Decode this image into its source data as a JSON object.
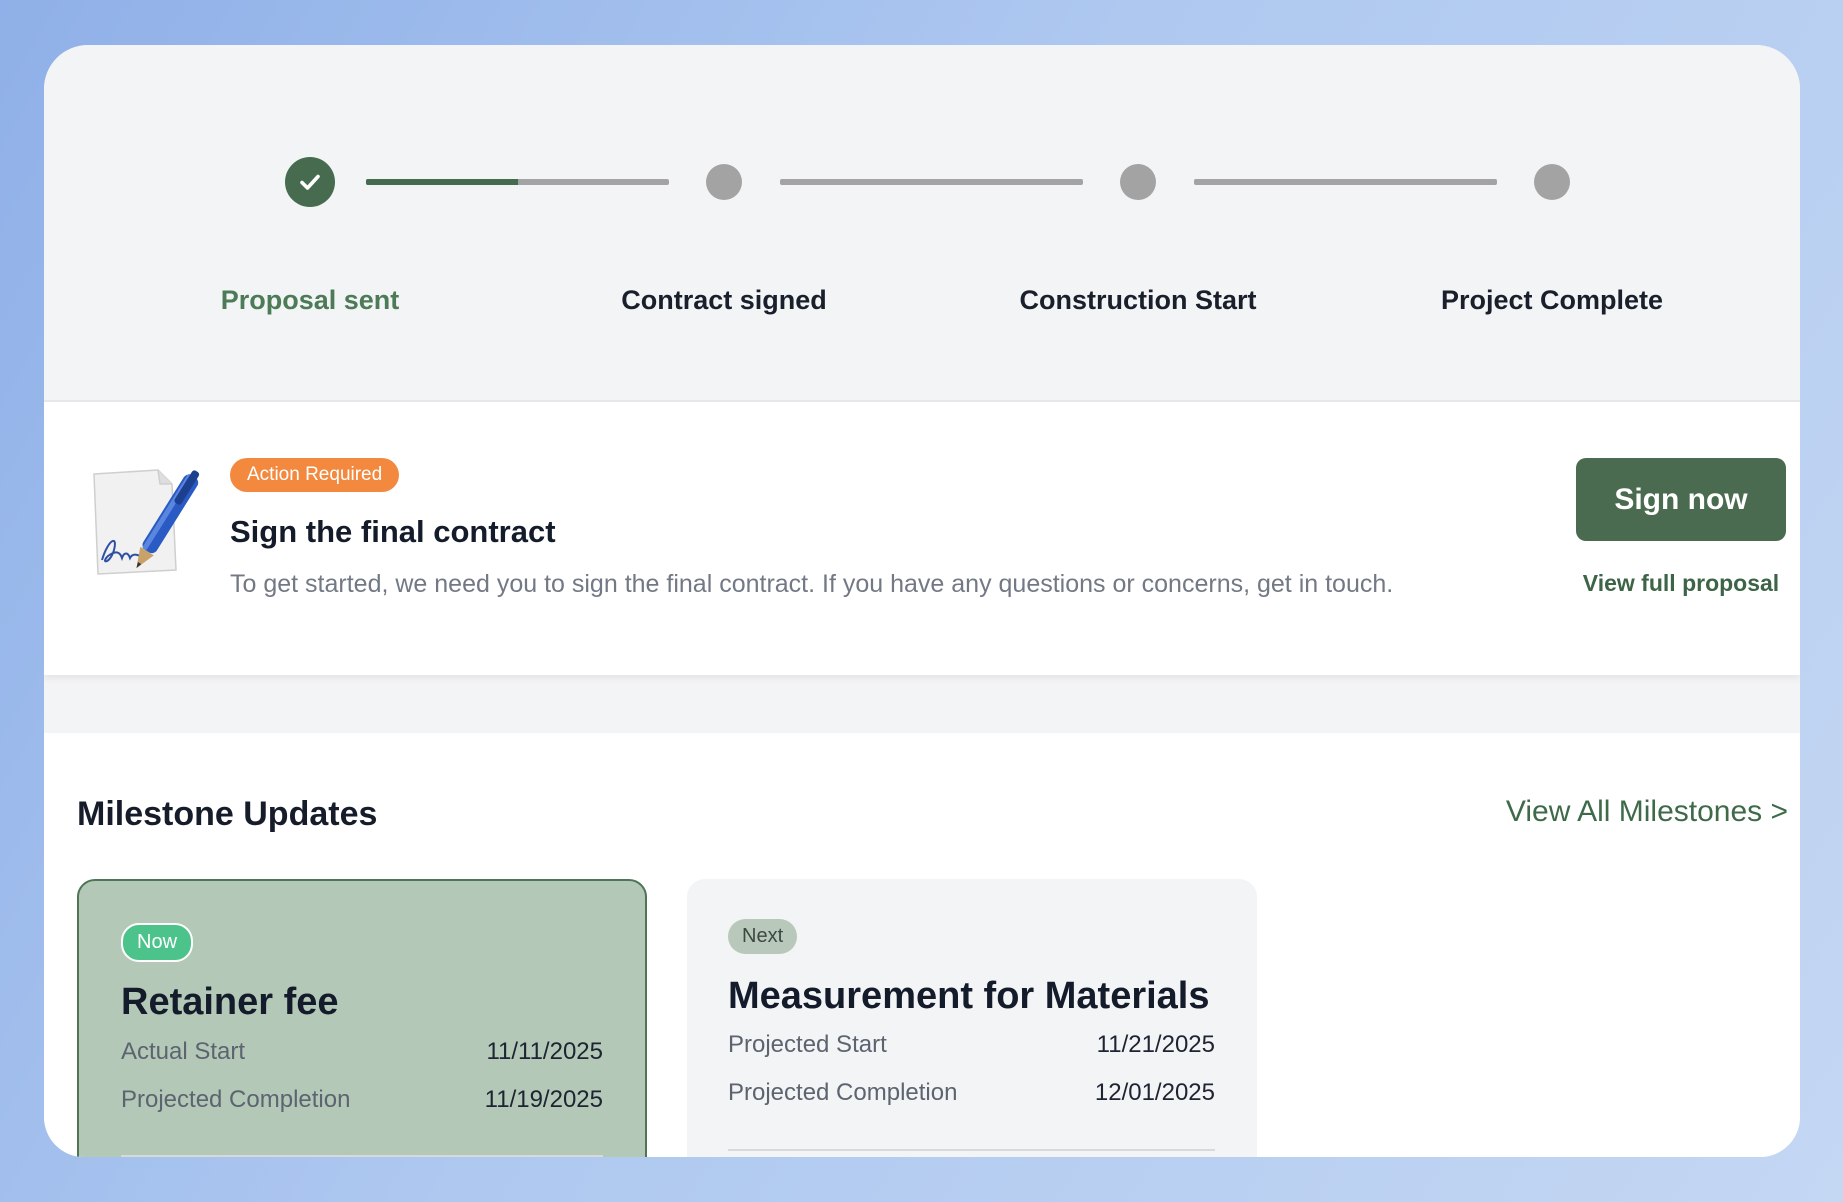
{
  "stepper": {
    "steps": [
      {
        "label": "Proposal sent",
        "status": "complete"
      },
      {
        "label": "Contract signed",
        "status": "pending"
      },
      {
        "label": "Construction Start",
        "status": "pending"
      },
      {
        "label": "Project Complete",
        "status": "pending"
      }
    ],
    "first_connector_progress": 0.5
  },
  "action": {
    "badge": "Action Required",
    "title": "Sign the final contract",
    "description": "To get started, we need you to sign the final contract. If you have any questions or concerns, get in touch.",
    "sign_button": "Sign now",
    "proposal_link": "View full proposal"
  },
  "milestones": {
    "title": "Milestone Updates",
    "view_all": "View All Milestones >",
    "cards": [
      {
        "badge": "Now",
        "name": "Retainer fee",
        "rows": [
          {
            "label": "Actual Start",
            "value": "11/11/2025"
          },
          {
            "label": "Projected Completion",
            "value": "11/19/2025"
          }
        ]
      },
      {
        "badge": "Next",
        "name": "Measurement for Materials",
        "rows": [
          {
            "label": "Projected Start",
            "value": "11/21/2025"
          },
          {
            "label": "Projected Completion",
            "value": "12/01/2025"
          }
        ]
      }
    ]
  },
  "colors": {
    "brand_green": "#476b4f",
    "action_orange": "#f3893e",
    "now_badge": "#4cc38a",
    "current_card": "#b4c8b7"
  },
  "icons": {
    "step_complete": "check-icon",
    "contract": "contract-signature-icon"
  }
}
